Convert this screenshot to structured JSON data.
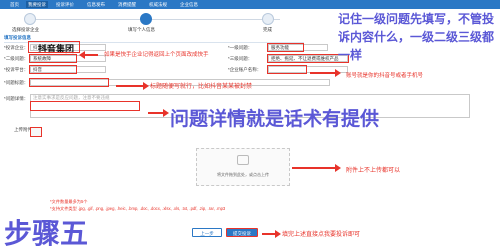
{
  "nav": {
    "items": [
      "首页",
      "我要投诉",
      "投诉评价",
      "信息发布",
      "消费提醒",
      "权威法规",
      "企业信息"
    ],
    "active_index": 1
  },
  "steps": {
    "labels": [
      "选择投诉企业",
      "填写个人信息",
      "完成"
    ],
    "active_index": 1
  },
  "form": {
    "section_title": "填写投诉信息",
    "fields": {
      "complaint_company_label": "*投诉企业：",
      "complaint_company_value": "抖音集团",
      "level1_label": "*一级问题：",
      "level1_value": "服务功能",
      "level2_label": "*二级问题：",
      "level2_value": "系统故障",
      "level3_label": "*三级问题：",
      "level3_value": "拒绝、拖延、不让退费或维权产品",
      "platform_label": "*投诉平台：",
      "platform_value": "抖音",
      "account_label": "*企业账户名称：",
      "account_value": "",
      "title_label": "*问题标题：",
      "title_value": "",
      "detail_label": "*问题详情：",
      "detail_placeholder": "注意实事求是反应问题，注意不要违规",
      "upload_label": "上传附件：",
      "upload_hint": "将文件拖到此处，或点击上传"
    },
    "footer_note_1": "*文件数量最多为5个",
    "footer_note_2": "*支持文件类型 .jpg, .gif, .png, .jpeg, .heic, .bmp, .doc, .docx, .xlsx, .xls, .txt, .pdf, .zip, .rar, .mp3",
    "prev_button": "上一步",
    "submit_button": "提交投诉"
  },
  "annotations": {
    "top_right": "记住一级问题先填写，不管投诉内容什么，一级二级三级都一样",
    "company_note": "如果是快手企业记得返回上个页面改成快手",
    "company_overlay": "抖音集团",
    "account_note": "账号就是你的抖音号或者手机号",
    "title_note": "标题随便写就行，比如抖音某某被封禁",
    "detail_big": "问题详情就是话术有提供",
    "upload_note": "附件上不上传都可以",
    "submit_note": "填完上述直接点我要投诉即可",
    "step_big": "步骤五"
  },
  "colors": {
    "nav": "#2b78c5",
    "annotation_red": "#e8332a",
    "annotation_purple": "#5b58d6"
  }
}
